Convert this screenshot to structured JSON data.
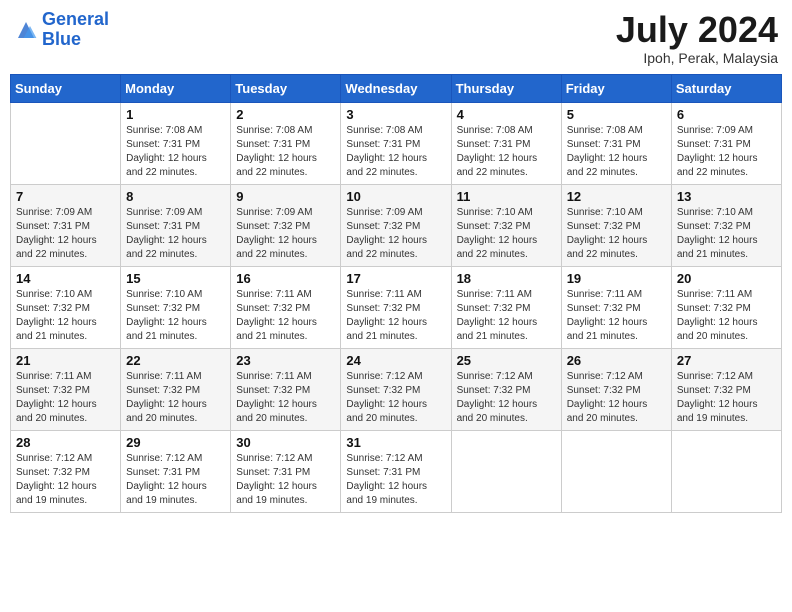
{
  "header": {
    "logo_line1": "General",
    "logo_line2": "Blue",
    "month": "July 2024",
    "location": "Ipoh, Perak, Malaysia"
  },
  "weekdays": [
    "Sunday",
    "Monday",
    "Tuesday",
    "Wednesday",
    "Thursday",
    "Friday",
    "Saturday"
  ],
  "weeks": [
    [
      {
        "day": "",
        "sunrise": "",
        "sunset": "",
        "daylight": ""
      },
      {
        "day": "1",
        "sunrise": "Sunrise: 7:08 AM",
        "sunset": "Sunset: 7:31 PM",
        "daylight": "Daylight: 12 hours and 22 minutes."
      },
      {
        "day": "2",
        "sunrise": "Sunrise: 7:08 AM",
        "sunset": "Sunset: 7:31 PM",
        "daylight": "Daylight: 12 hours and 22 minutes."
      },
      {
        "day": "3",
        "sunrise": "Sunrise: 7:08 AM",
        "sunset": "Sunset: 7:31 PM",
        "daylight": "Daylight: 12 hours and 22 minutes."
      },
      {
        "day": "4",
        "sunrise": "Sunrise: 7:08 AM",
        "sunset": "Sunset: 7:31 PM",
        "daylight": "Daylight: 12 hours and 22 minutes."
      },
      {
        "day": "5",
        "sunrise": "Sunrise: 7:08 AM",
        "sunset": "Sunset: 7:31 PM",
        "daylight": "Daylight: 12 hours and 22 minutes."
      },
      {
        "day": "6",
        "sunrise": "Sunrise: 7:09 AM",
        "sunset": "Sunset: 7:31 PM",
        "daylight": "Daylight: 12 hours and 22 minutes."
      }
    ],
    [
      {
        "day": "7",
        "sunrise": "Sunrise: 7:09 AM",
        "sunset": "Sunset: 7:31 PM",
        "daylight": "Daylight: 12 hours and 22 minutes."
      },
      {
        "day": "8",
        "sunrise": "Sunrise: 7:09 AM",
        "sunset": "Sunset: 7:31 PM",
        "daylight": "Daylight: 12 hours and 22 minutes."
      },
      {
        "day": "9",
        "sunrise": "Sunrise: 7:09 AM",
        "sunset": "Sunset: 7:32 PM",
        "daylight": "Daylight: 12 hours and 22 minutes."
      },
      {
        "day": "10",
        "sunrise": "Sunrise: 7:09 AM",
        "sunset": "Sunset: 7:32 PM",
        "daylight": "Daylight: 12 hours and 22 minutes."
      },
      {
        "day": "11",
        "sunrise": "Sunrise: 7:10 AM",
        "sunset": "Sunset: 7:32 PM",
        "daylight": "Daylight: 12 hours and 22 minutes."
      },
      {
        "day": "12",
        "sunrise": "Sunrise: 7:10 AM",
        "sunset": "Sunset: 7:32 PM",
        "daylight": "Daylight: 12 hours and 22 minutes."
      },
      {
        "day": "13",
        "sunrise": "Sunrise: 7:10 AM",
        "sunset": "Sunset: 7:32 PM",
        "daylight": "Daylight: 12 hours and 21 minutes."
      }
    ],
    [
      {
        "day": "14",
        "sunrise": "Sunrise: 7:10 AM",
        "sunset": "Sunset: 7:32 PM",
        "daylight": "Daylight: 12 hours and 21 minutes."
      },
      {
        "day": "15",
        "sunrise": "Sunrise: 7:10 AM",
        "sunset": "Sunset: 7:32 PM",
        "daylight": "Daylight: 12 hours and 21 minutes."
      },
      {
        "day": "16",
        "sunrise": "Sunrise: 7:11 AM",
        "sunset": "Sunset: 7:32 PM",
        "daylight": "Daylight: 12 hours and 21 minutes."
      },
      {
        "day": "17",
        "sunrise": "Sunrise: 7:11 AM",
        "sunset": "Sunset: 7:32 PM",
        "daylight": "Daylight: 12 hours and 21 minutes."
      },
      {
        "day": "18",
        "sunrise": "Sunrise: 7:11 AM",
        "sunset": "Sunset: 7:32 PM",
        "daylight": "Daylight: 12 hours and 21 minutes."
      },
      {
        "day": "19",
        "sunrise": "Sunrise: 7:11 AM",
        "sunset": "Sunset: 7:32 PM",
        "daylight": "Daylight: 12 hours and 21 minutes."
      },
      {
        "day": "20",
        "sunrise": "Sunrise: 7:11 AM",
        "sunset": "Sunset: 7:32 PM",
        "daylight": "Daylight: 12 hours and 20 minutes."
      }
    ],
    [
      {
        "day": "21",
        "sunrise": "Sunrise: 7:11 AM",
        "sunset": "Sunset: 7:32 PM",
        "daylight": "Daylight: 12 hours and 20 minutes."
      },
      {
        "day": "22",
        "sunrise": "Sunrise: 7:11 AM",
        "sunset": "Sunset: 7:32 PM",
        "daylight": "Daylight: 12 hours and 20 minutes."
      },
      {
        "day": "23",
        "sunrise": "Sunrise: 7:11 AM",
        "sunset": "Sunset: 7:32 PM",
        "daylight": "Daylight: 12 hours and 20 minutes."
      },
      {
        "day": "24",
        "sunrise": "Sunrise: 7:12 AM",
        "sunset": "Sunset: 7:32 PM",
        "daylight": "Daylight: 12 hours and 20 minutes."
      },
      {
        "day": "25",
        "sunrise": "Sunrise: 7:12 AM",
        "sunset": "Sunset: 7:32 PM",
        "daylight": "Daylight: 12 hours and 20 minutes."
      },
      {
        "day": "26",
        "sunrise": "Sunrise: 7:12 AM",
        "sunset": "Sunset: 7:32 PM",
        "daylight": "Daylight: 12 hours and 20 minutes."
      },
      {
        "day": "27",
        "sunrise": "Sunrise: 7:12 AM",
        "sunset": "Sunset: 7:32 PM",
        "daylight": "Daylight: 12 hours and 19 minutes."
      }
    ],
    [
      {
        "day": "28",
        "sunrise": "Sunrise: 7:12 AM",
        "sunset": "Sunset: 7:32 PM",
        "daylight": "Daylight: 12 hours and 19 minutes."
      },
      {
        "day": "29",
        "sunrise": "Sunrise: 7:12 AM",
        "sunset": "Sunset: 7:31 PM",
        "daylight": "Daylight: 12 hours and 19 minutes."
      },
      {
        "day": "30",
        "sunrise": "Sunrise: 7:12 AM",
        "sunset": "Sunset: 7:31 PM",
        "daylight": "Daylight: 12 hours and 19 minutes."
      },
      {
        "day": "31",
        "sunrise": "Sunrise: 7:12 AM",
        "sunset": "Sunset: 7:31 PM",
        "daylight": "Daylight: 12 hours and 19 minutes."
      },
      {
        "day": "",
        "sunrise": "",
        "sunset": "",
        "daylight": ""
      },
      {
        "day": "",
        "sunrise": "",
        "sunset": "",
        "daylight": ""
      },
      {
        "day": "",
        "sunrise": "",
        "sunset": "",
        "daylight": ""
      }
    ]
  ]
}
